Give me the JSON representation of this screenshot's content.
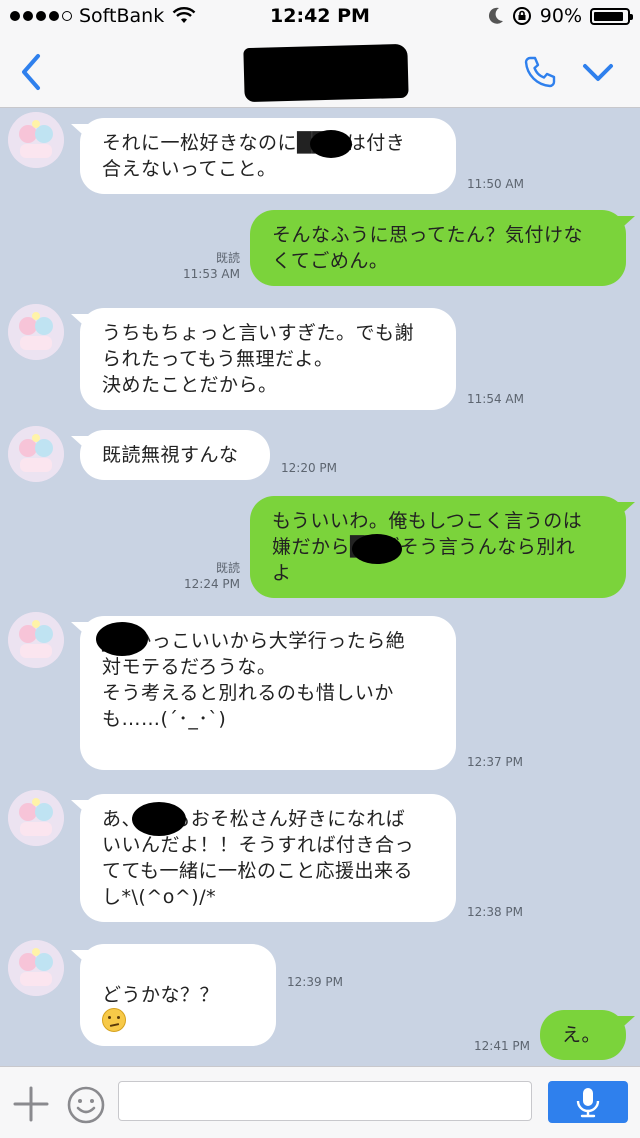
{
  "status": {
    "carrier": "SoftBank",
    "time": "12:42 PM",
    "battery": "90%",
    "battery_level": 0.9
  },
  "header": {
    "title_redacted": true
  },
  "messages": [
    {
      "side": "in",
      "text": "それに一松好きなのに██とは付き\n合えないってこと。",
      "time": "11:50 AM"
    },
    {
      "side": "out",
      "text": "そんなふうに思ってたん？気付けな\nくてごめん。",
      "read": "既読",
      "time": "11:53 AM"
    },
    {
      "side": "in",
      "text": "うちもちょっと言いすぎた。でも謝\nられたってもう無理だよ。\n決めたことだから。",
      "time": "11:54 AM"
    },
    {
      "side": "in",
      "text": "既読無視すんな",
      "time": "12:20 PM"
    },
    {
      "side": "out",
      "text": "もういいわ。俺もしつこく言うのは\n嫌だから██がそう言うんなら別れ\nよ",
      "read": "既読",
      "time": "12:24 PM"
    },
    {
      "side": "in",
      "text": "██かっこいいから大学行ったら絶\n対モテるだろうな。\nそう考えると別れるのも惜しいか\nも……(´･_･`)",
      "time": "12:37 PM"
    },
    {
      "side": "in",
      "text": "あ、██もおそ松さん好きになれば\nいいんだよ！！そうすれば付き合っ\nてても一緒に一松のこと応援出来る\nし*\\(^o^)/*",
      "time": "12:38 PM"
    },
    {
      "side": "in",
      "text": "どうかな？？",
      "emoji": "confused-face",
      "time": "12:39 PM"
    },
    {
      "side": "out",
      "text": "え。",
      "time": "12:41 PM"
    }
  ],
  "input": {
    "placeholder": ""
  },
  "colors": {
    "chat_bg": "#c9d3e3",
    "out_bubble": "#7bd33b",
    "accent": "#2f80ed"
  }
}
